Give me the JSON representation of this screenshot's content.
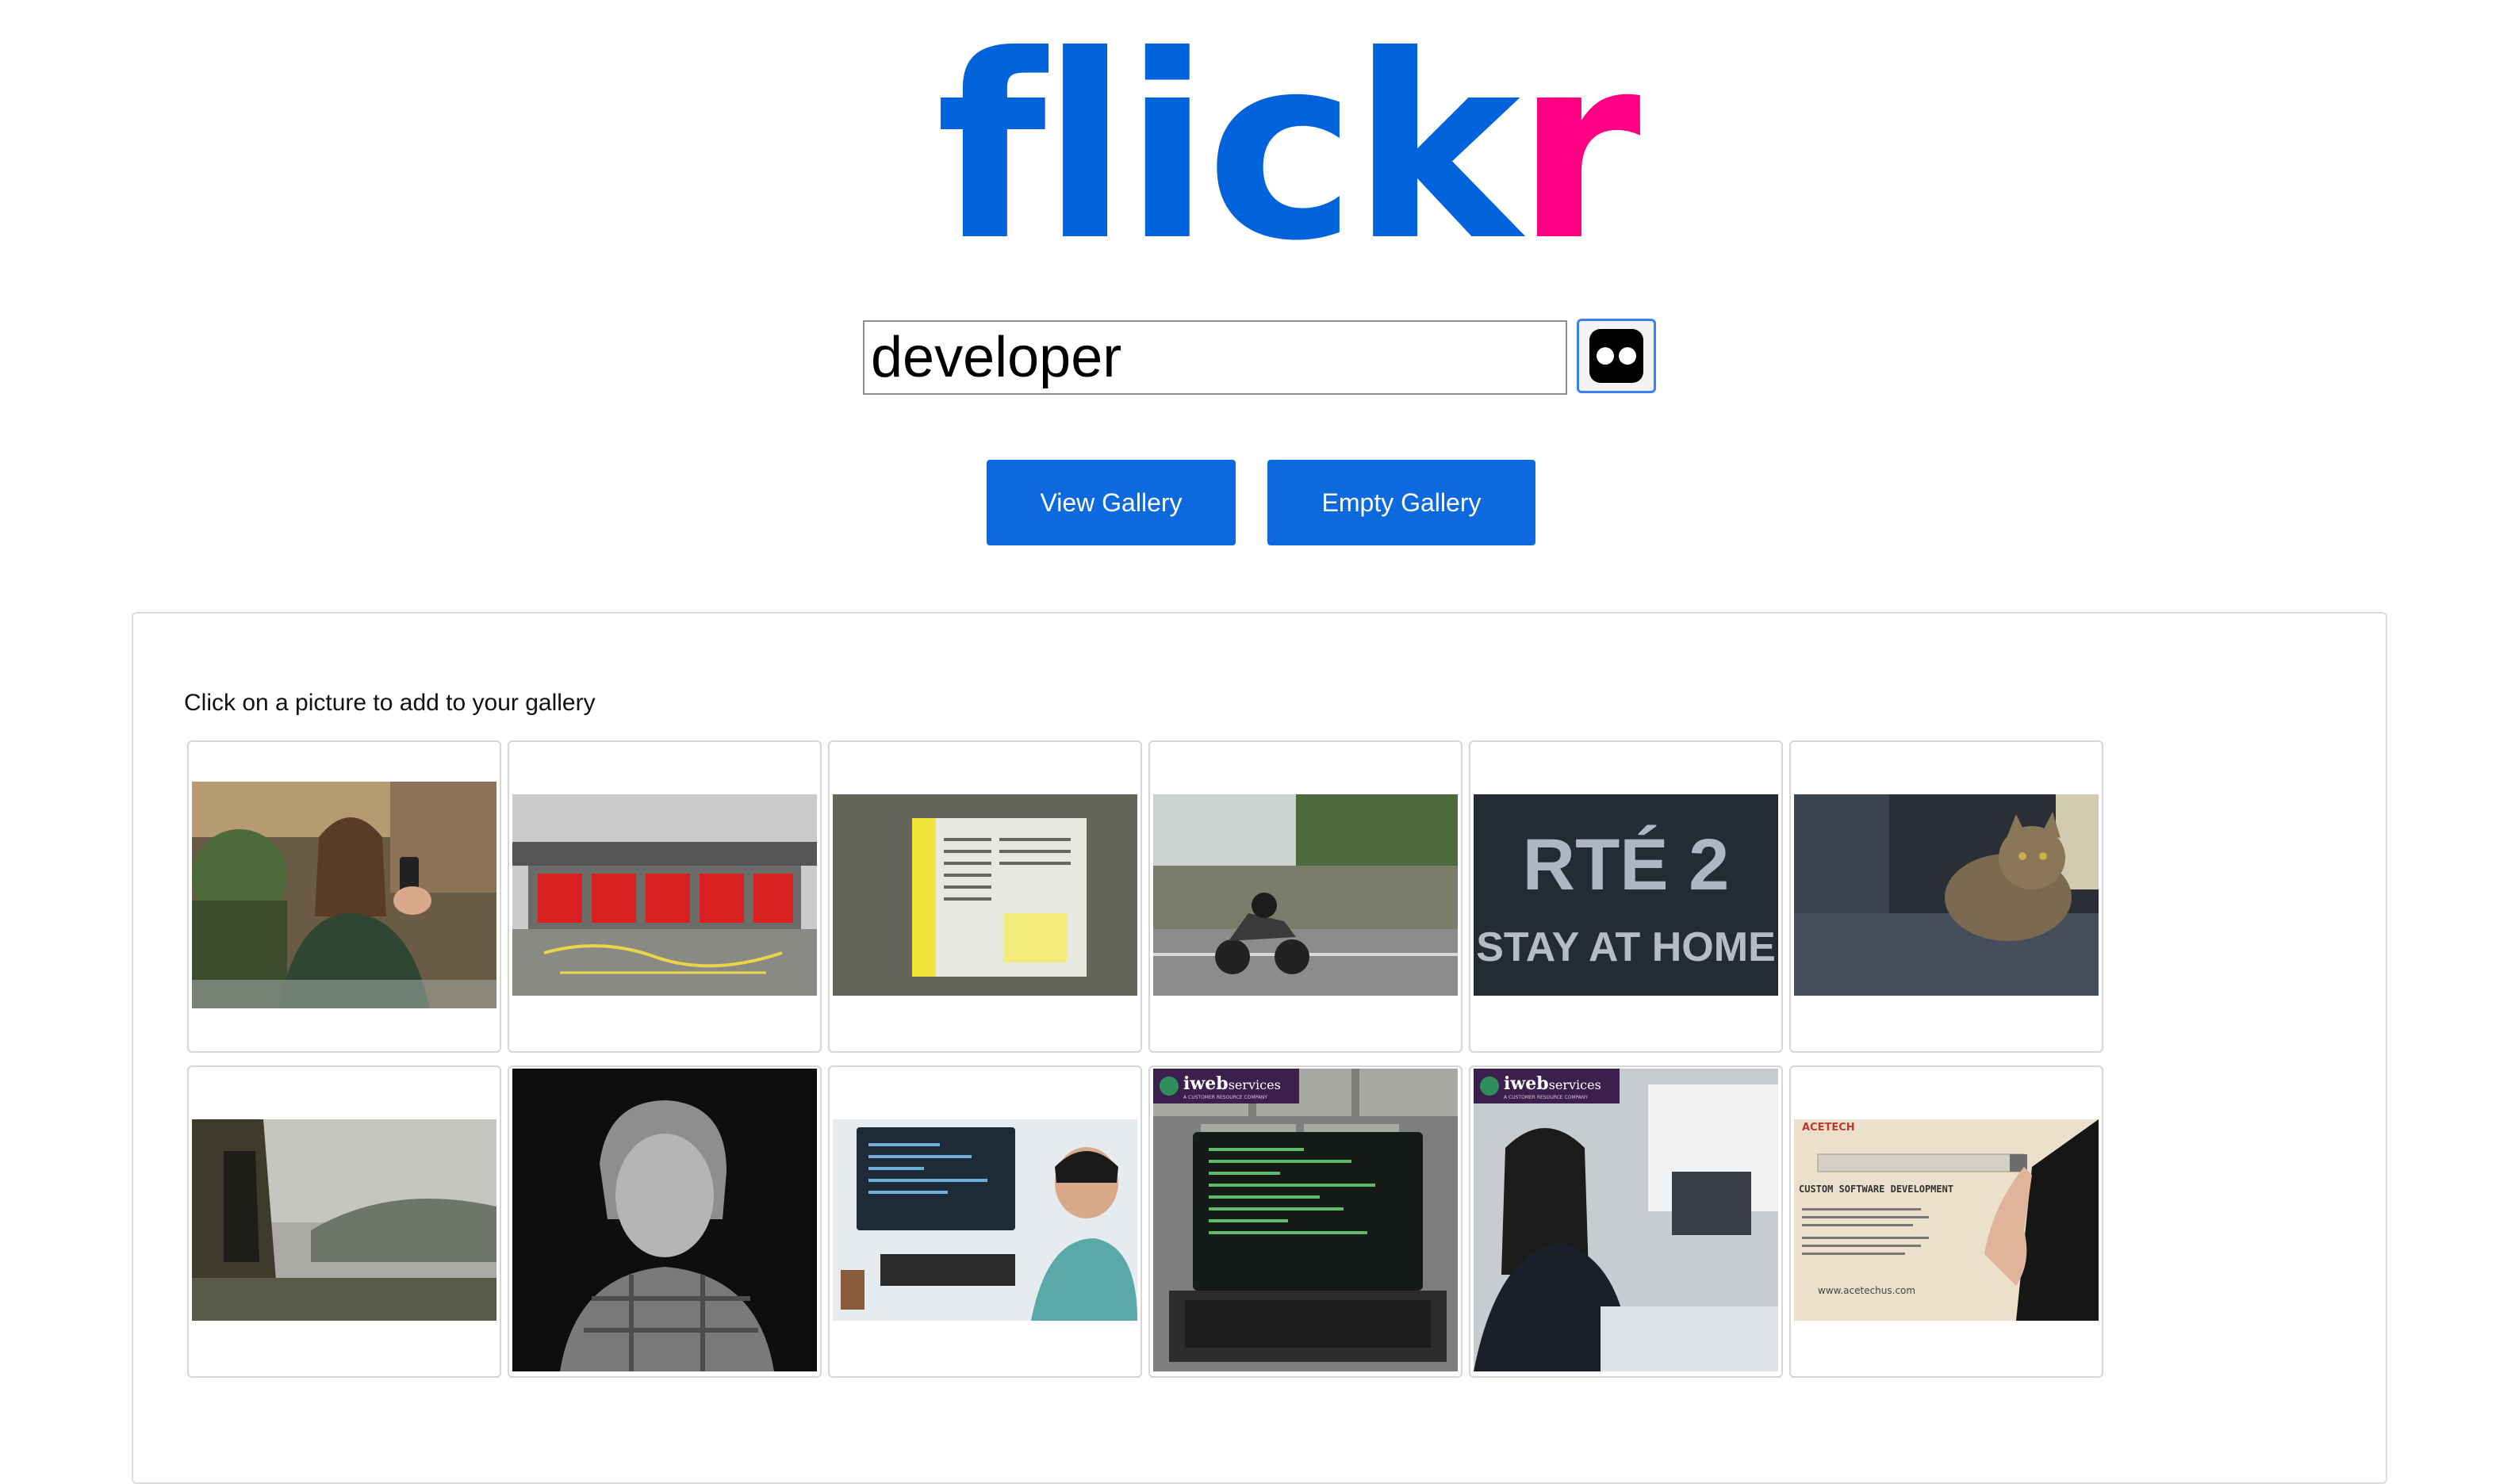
{
  "logo": {
    "text_blue": "flick",
    "text_pink": "r",
    "colors": {
      "blue": "#0063dc",
      "pink": "#ff0084"
    }
  },
  "search": {
    "value": "developer",
    "button_icon": "flickr-icon"
  },
  "buttons": {
    "view_gallery": "View Gallery",
    "empty_gallery": "Empty Gallery"
  },
  "results": {
    "instruction": "Click on a picture to add to your gallery",
    "photos": [
      {
        "name": "woman-with-phone-photo"
      },
      {
        "name": "fire-station-doors-photo"
      },
      {
        "name": "notice-on-fence-photo"
      },
      {
        "name": "motorcycle-on-road-photo"
      },
      {
        "name": "rte2-stay-at-home-photo",
        "text_line1": "RTÉ 2",
        "text_line2": "STAY AT HOME"
      },
      {
        "name": "cat-on-sofa-photo"
      },
      {
        "name": "misty-ruin-photo"
      },
      {
        "name": "woman-portrait-bw-photo"
      },
      {
        "name": "developer-at-computer-photo"
      },
      {
        "name": "iweb-laptop-code-photo",
        "brand": "iweb",
        "brand_suffix": "services",
        "tagline": "A CUSTOMER RESOURCE COMPANY"
      },
      {
        "name": "iweb-office-photo",
        "brand": "iweb",
        "brand_suffix": "services",
        "tagline": "A CUSTOMER RESOURCE COMPANY"
      },
      {
        "name": "acetech-software-photo",
        "brand": "ACETECH",
        "heading": "CUSTOM SOFTWARE DEVELOPMENT",
        "url": "www.acetechus.com"
      }
    ]
  },
  "colors": {
    "button_bg": "#0d6ade",
    "search_button_border": "#3b82f6",
    "card_border": "#d6d6d6"
  }
}
